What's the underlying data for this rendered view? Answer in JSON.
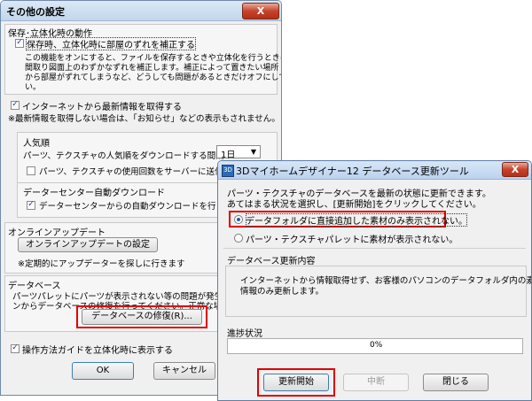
{
  "settings_dialog": {
    "title": "その他の設定",
    "close_label": "X",
    "save_group": {
      "title": "保存･立体化時の動作",
      "checkbox_label": "保存時、立体化時に部屋のずれを補正する",
      "description": [
        "この機能をオンにすると、ファイルを保存するときや立体化を行うときに",
        "間取り図面上のわずかなずれを補正します。補正によって置きたい場所",
        "から部屋がずれてしまうなど、どうしても問題があるときだけオフにしてくださ",
        "い。"
      ]
    },
    "internet": {
      "checkbox_label": "インターネットから最新情報を取得する",
      "note": "※最新情報を取得しない場合は、「お知らせ」などの表示もされません。",
      "popularity": {
        "title": "人気順",
        "download_label": "パーツ、テクスチャの人気順をダウンロードする間隔",
        "interval_value": "1日",
        "send_label": "パーツ、テクスチャの使用回数をサーバーに送信する"
      },
      "datacenter": {
        "title": "データーセンター自動ダウンロード",
        "checkbox_label": "データーセンターからの自動ダウンロードを行う"
      }
    },
    "online_update": {
      "title": "オンラインアップデート",
      "button_label": "オンラインアップデートの設定",
      "note": "※定期的にアップデーターを探しに行きます"
    },
    "database": {
      "title": "データベース",
      "description": [
        "パーツパレットにパーツが表示されない等の問題が発生した場",
        "ンからデータベースの修復を行ってください。正常な場合は行わ"
      ],
      "repair_button_label": "データベースの修復(R)..."
    },
    "guide_checkbox_label": "操作方法ガイドを立体化時に表示する",
    "ok_label": "OK",
    "cancel_label": "キャンセル"
  },
  "db_tool_dialog": {
    "icon_label": "3D",
    "title": "3Dマイホームデザイナー12 データベース更新ツール",
    "close_label": "X",
    "intro": [
      "パーツ・テクスチャのデータベースを最新の状態に更新できます。",
      "あてはまる状況を選択し、[更新開始]をクリックしてください。"
    ],
    "options": [
      {
        "label": "データフォルダに直接追加した素材のみ表示されない。",
        "selected": true
      },
      {
        "label": "パーツ・テクスチャパレットに素材が表示されない。",
        "selected": false
      }
    ],
    "content_title": "データベース更新内容",
    "content_text": [
      "インターネットから情報取得せず、お客様のパソコンのデータフォルダ内の素材",
      "情報のみ更新します。"
    ],
    "progress_title": "進捗状況",
    "progress_percent": "0%",
    "progress_value": 0,
    "start_label": "更新開始",
    "interrupt_label": "中断",
    "close_button_label": "閉じる"
  },
  "colors": {
    "highlight_red": "#e00000",
    "close_button_red": "#c7432a",
    "titlebar_blue": "#c2d6ec"
  }
}
